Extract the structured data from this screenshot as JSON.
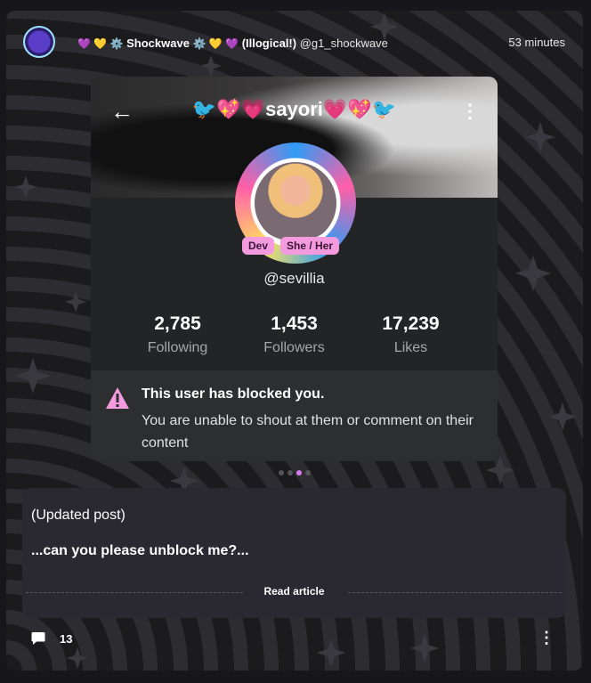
{
  "post": {
    "author_hearts_left": "💜 💛 ⚙️",
    "author_nick": "Shockwave",
    "author_hearts_right": "⚙️ 💛 💜",
    "author_tag": "(Illogical!)",
    "author_handle": "@g1_shockwave",
    "time": "53 minutes"
  },
  "screenshot": {
    "profile_name": "🐦💖💗sayori💗💖🐦",
    "badges": [
      "Dev",
      "She / Her"
    ],
    "username": "@sevillia",
    "stats": [
      {
        "value": "2,785",
        "label": "Following"
      },
      {
        "value": "1,453",
        "label": "Followers"
      },
      {
        "value": "17,239",
        "label": "Likes"
      }
    ],
    "blocked_title": "This user has blocked you.",
    "blocked_desc": "You are unable to shout at them or comment on their content"
  },
  "carousel": {
    "count": 4,
    "active_index": 2
  },
  "article": {
    "title": "(Updated post)",
    "body": "...can you please unblock me?...",
    "read_label": "Read article"
  },
  "footer": {
    "comment_count": "13"
  },
  "colors": {
    "accent": "#f49be0",
    "dot_active": "#d67cf0",
    "warning": "#f49be0"
  }
}
